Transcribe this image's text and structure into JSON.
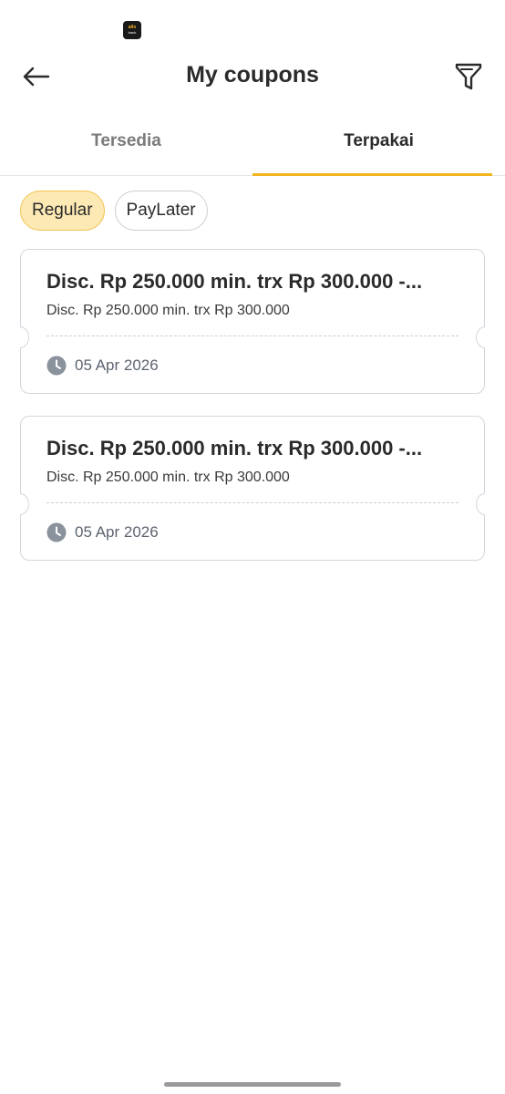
{
  "status_bar": {
    "logo_top": "allo",
    "logo_bottom": "bank"
  },
  "header": {
    "title": "My coupons",
    "back_icon": "arrow-left-icon",
    "filter_icon": "filter-icon"
  },
  "tabs": [
    {
      "label": "Tersedia",
      "active": false
    },
    {
      "label": "Terpakai",
      "active": true
    }
  ],
  "chips": [
    {
      "label": "Regular",
      "selected": true
    },
    {
      "label": "PayLater",
      "selected": false
    }
  ],
  "coupons": [
    {
      "title": "Disc. Rp 250.000 min. trx Rp 300.000 -...",
      "description": "Disc. Rp 250.000 min. trx Rp 300.000",
      "date": "05 Apr 2026"
    },
    {
      "title": "Disc. Rp 250.000 min. trx Rp 300.000 -...",
      "description": "Disc. Rp 250.000 min. trx Rp 300.000",
      "date": "05 Apr 2026"
    }
  ],
  "colors": {
    "accent": "#f2b51f",
    "chip_selected_bg": "#fde9b4",
    "card_border": "#d2d7dd",
    "clock_icon": "#8a929c"
  }
}
